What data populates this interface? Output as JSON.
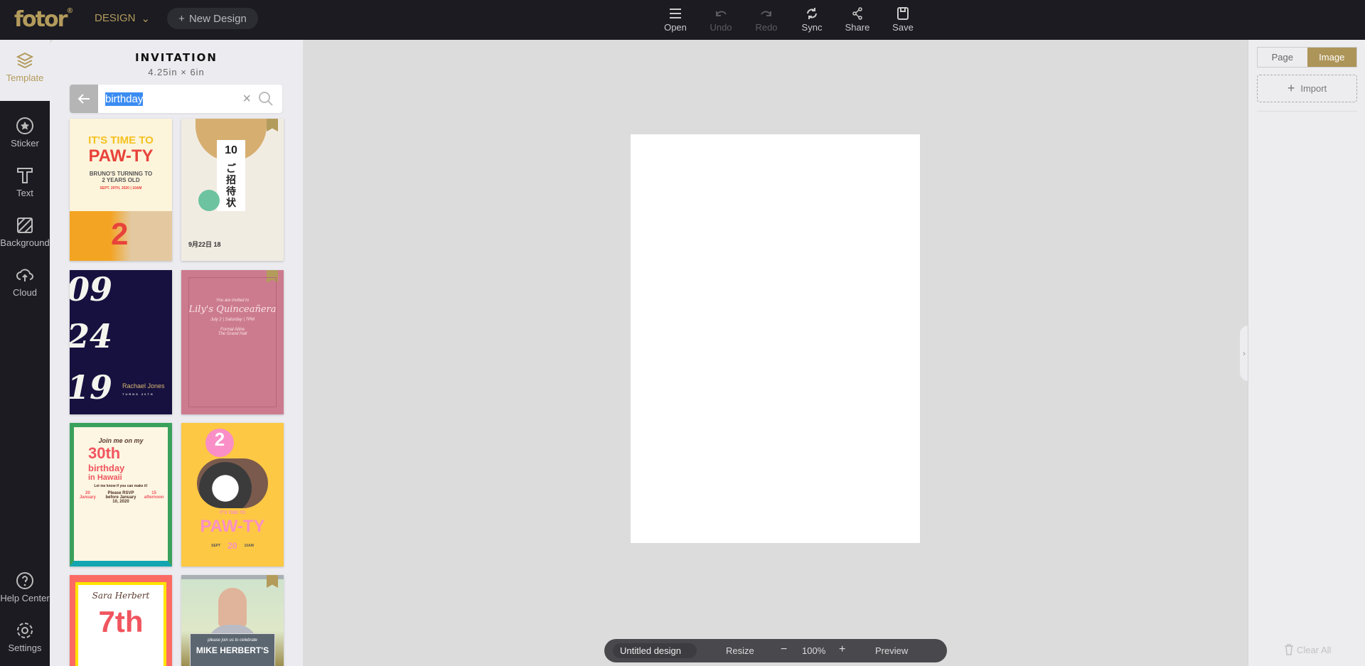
{
  "brand": {
    "logo": "fotor",
    "reg": "®",
    "color": "#b39b5c"
  },
  "header": {
    "design_label": "DESIGN",
    "new_design": "New Design",
    "tools": [
      {
        "label": "Open",
        "icon": "menu-icon",
        "enabled": true
      },
      {
        "label": "Undo",
        "icon": "undo-icon",
        "enabled": false
      },
      {
        "label": "Redo",
        "icon": "redo-icon",
        "enabled": false
      },
      {
        "label": "Sync",
        "icon": "sync-icon",
        "enabled": true
      },
      {
        "label": "Share",
        "icon": "share-icon",
        "enabled": true
      },
      {
        "label": "Save",
        "icon": "save-icon",
        "enabled": true
      }
    ]
  },
  "rail": {
    "items": [
      {
        "label": "Template",
        "icon": "layers-icon",
        "active": true
      },
      {
        "label": "Sticker",
        "icon": "star-circle-icon"
      },
      {
        "label": "Text",
        "icon": "text-icon"
      },
      {
        "label": "Background",
        "icon": "background-icon"
      },
      {
        "label": "Cloud",
        "icon": "cloud-upload-icon"
      }
    ],
    "bottom": [
      {
        "label": "Help Center",
        "icon": "help-icon"
      },
      {
        "label": "Settings",
        "icon": "gear-icon"
      }
    ]
  },
  "panel": {
    "title": "INVITATION",
    "size": "4.25in × 6in",
    "search": {
      "value": "birthday"
    },
    "templates": [
      {
        "lines": [
          "IT'S TIME TO",
          "PAW-TY",
          "BRUNO'S TURNING TO",
          "2 YEARS OLD",
          "SEPT. 20TH, 2020 | 10AM",
          "2"
        ],
        "bg": "#fdf4dc",
        "premium": false
      },
      {
        "lines": [
          "10",
          "ご招待状",
          "9月22日 18"
        ],
        "bg": "#f1ece2",
        "premium": true
      },
      {
        "lines": [
          "09",
          "24",
          "19",
          "Rachael Jones",
          "TURNS 30TH"
        ],
        "bg": "#16113f",
        "premium": false
      },
      {
        "lines": [
          "You are invited to",
          "Lily's Quinceañera",
          "July 2 | Saturday | 7PM",
          "Formal Attire",
          "The Grand Hall"
        ],
        "bg": "#cc7b8e",
        "premium": true
      },
      {
        "lines": [
          "Join me on my",
          "30th",
          "birthday",
          "in Hawaii",
          "Let me know if you can make it!",
          "20 January",
          "Please RSVP before January 10, 2020",
          "15 afternoon"
        ],
        "bg": "#fdf6e2",
        "premium": false
      },
      {
        "lines": [
          "2",
          "IT'S TIME TO",
          "PAW-TY",
          "SEPT",
          "20",
          "10AM"
        ],
        "bg": "#fdc843",
        "premium": false
      },
      {
        "lines": [
          "Sara Herbert",
          "7th"
        ],
        "bg": "#fb6b63",
        "premium": false
      },
      {
        "lines": [
          "please join us to celebrate",
          "MIKE HERBERT'S"
        ],
        "bg": "#b8c9b0",
        "premium": true
      }
    ]
  },
  "bottombar": {
    "doc_name": "Untitled design",
    "resize": "Resize",
    "zoom": "100%",
    "minus": "−",
    "plus": "+",
    "preview": "Preview"
  },
  "right": {
    "tabs": [
      {
        "label": "Page",
        "active": false
      },
      {
        "label": "Image",
        "active": true
      }
    ],
    "import": "Import",
    "clear_all": "Clear All"
  }
}
